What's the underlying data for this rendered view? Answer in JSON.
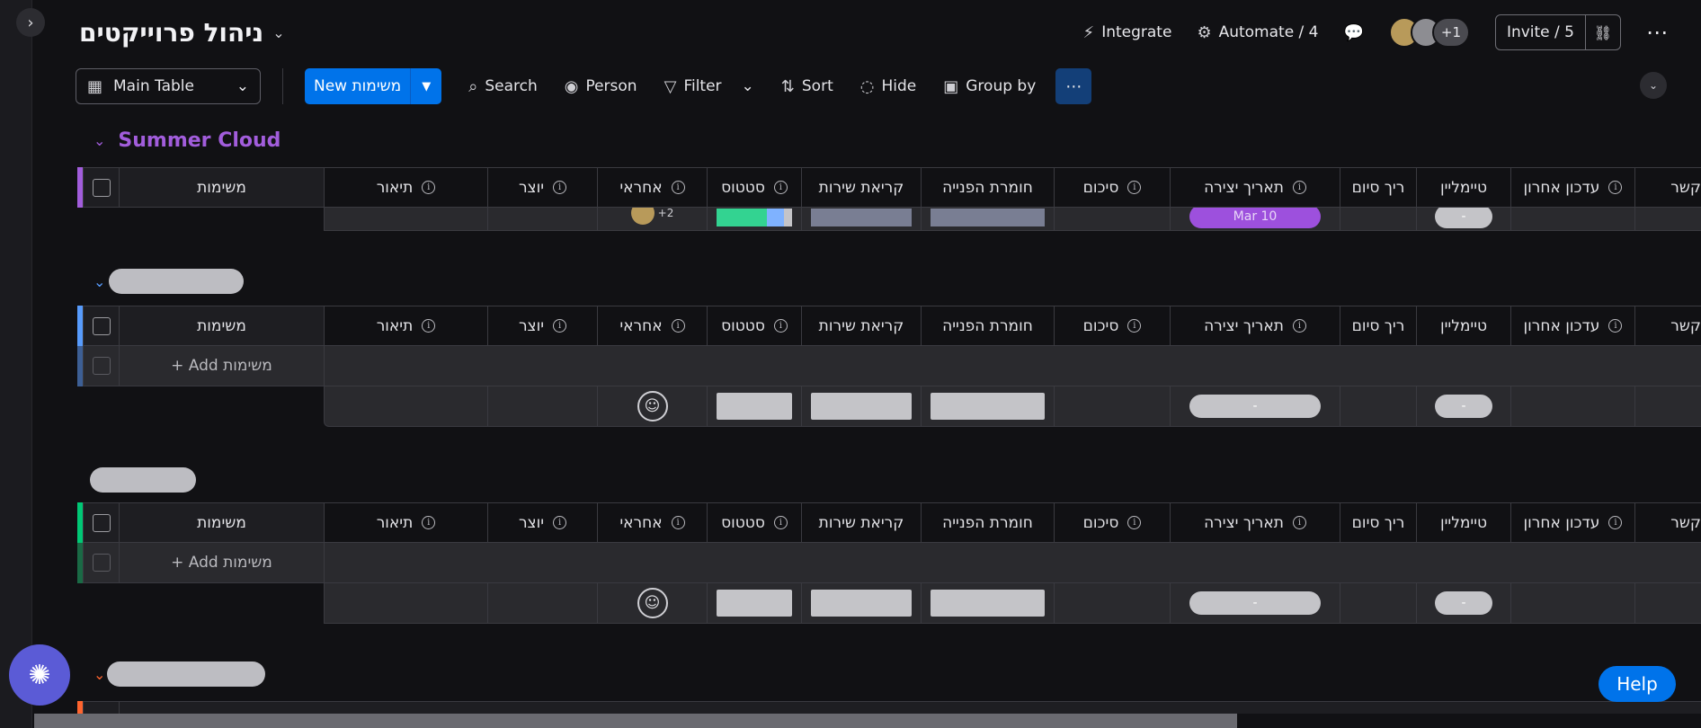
{
  "board": {
    "title": "ניהול פרוייקטים"
  },
  "top_actions": {
    "integrate": "Integrate",
    "automate": "Automate / 4",
    "more_members": "+1",
    "invite": "Invite / 5"
  },
  "toolbar": {
    "view": "Main Table",
    "new_item": "New משימות",
    "search": "Search",
    "person": "Person",
    "filter": "Filter",
    "sort": "Sort",
    "hide": "Hide",
    "group_by": "Group by"
  },
  "columns": [
    "משימות",
    "תיאור",
    "יוצר",
    "אחראי",
    "סטטוס",
    "קריאת שירות",
    "חומרת הפנייה",
    "סיכום",
    "תאריך יצירה",
    "ריך סיום",
    "טיימליין",
    "עדכון אחרון",
    "קשר"
  ],
  "groups": [
    {
      "name": "Summer Cloud",
      "color": "#a25ddc",
      "partial_row": {
        "people_extra": "+2",
        "created_date": "Mar 10",
        "timeline": "-"
      }
    },
    {
      "name": "",
      "color": "#579bfc",
      "add_item": "+ Add משימות",
      "summary": {
        "date": "-",
        "timeline": "-"
      }
    },
    {
      "name": "",
      "color": "#00c875",
      "add_item": "+ Add משימות",
      "summary": {
        "date": "-",
        "timeline": "-"
      }
    },
    {
      "name": "",
      "color": "#ff642e"
    }
  ],
  "help": {
    "label": "Help"
  }
}
